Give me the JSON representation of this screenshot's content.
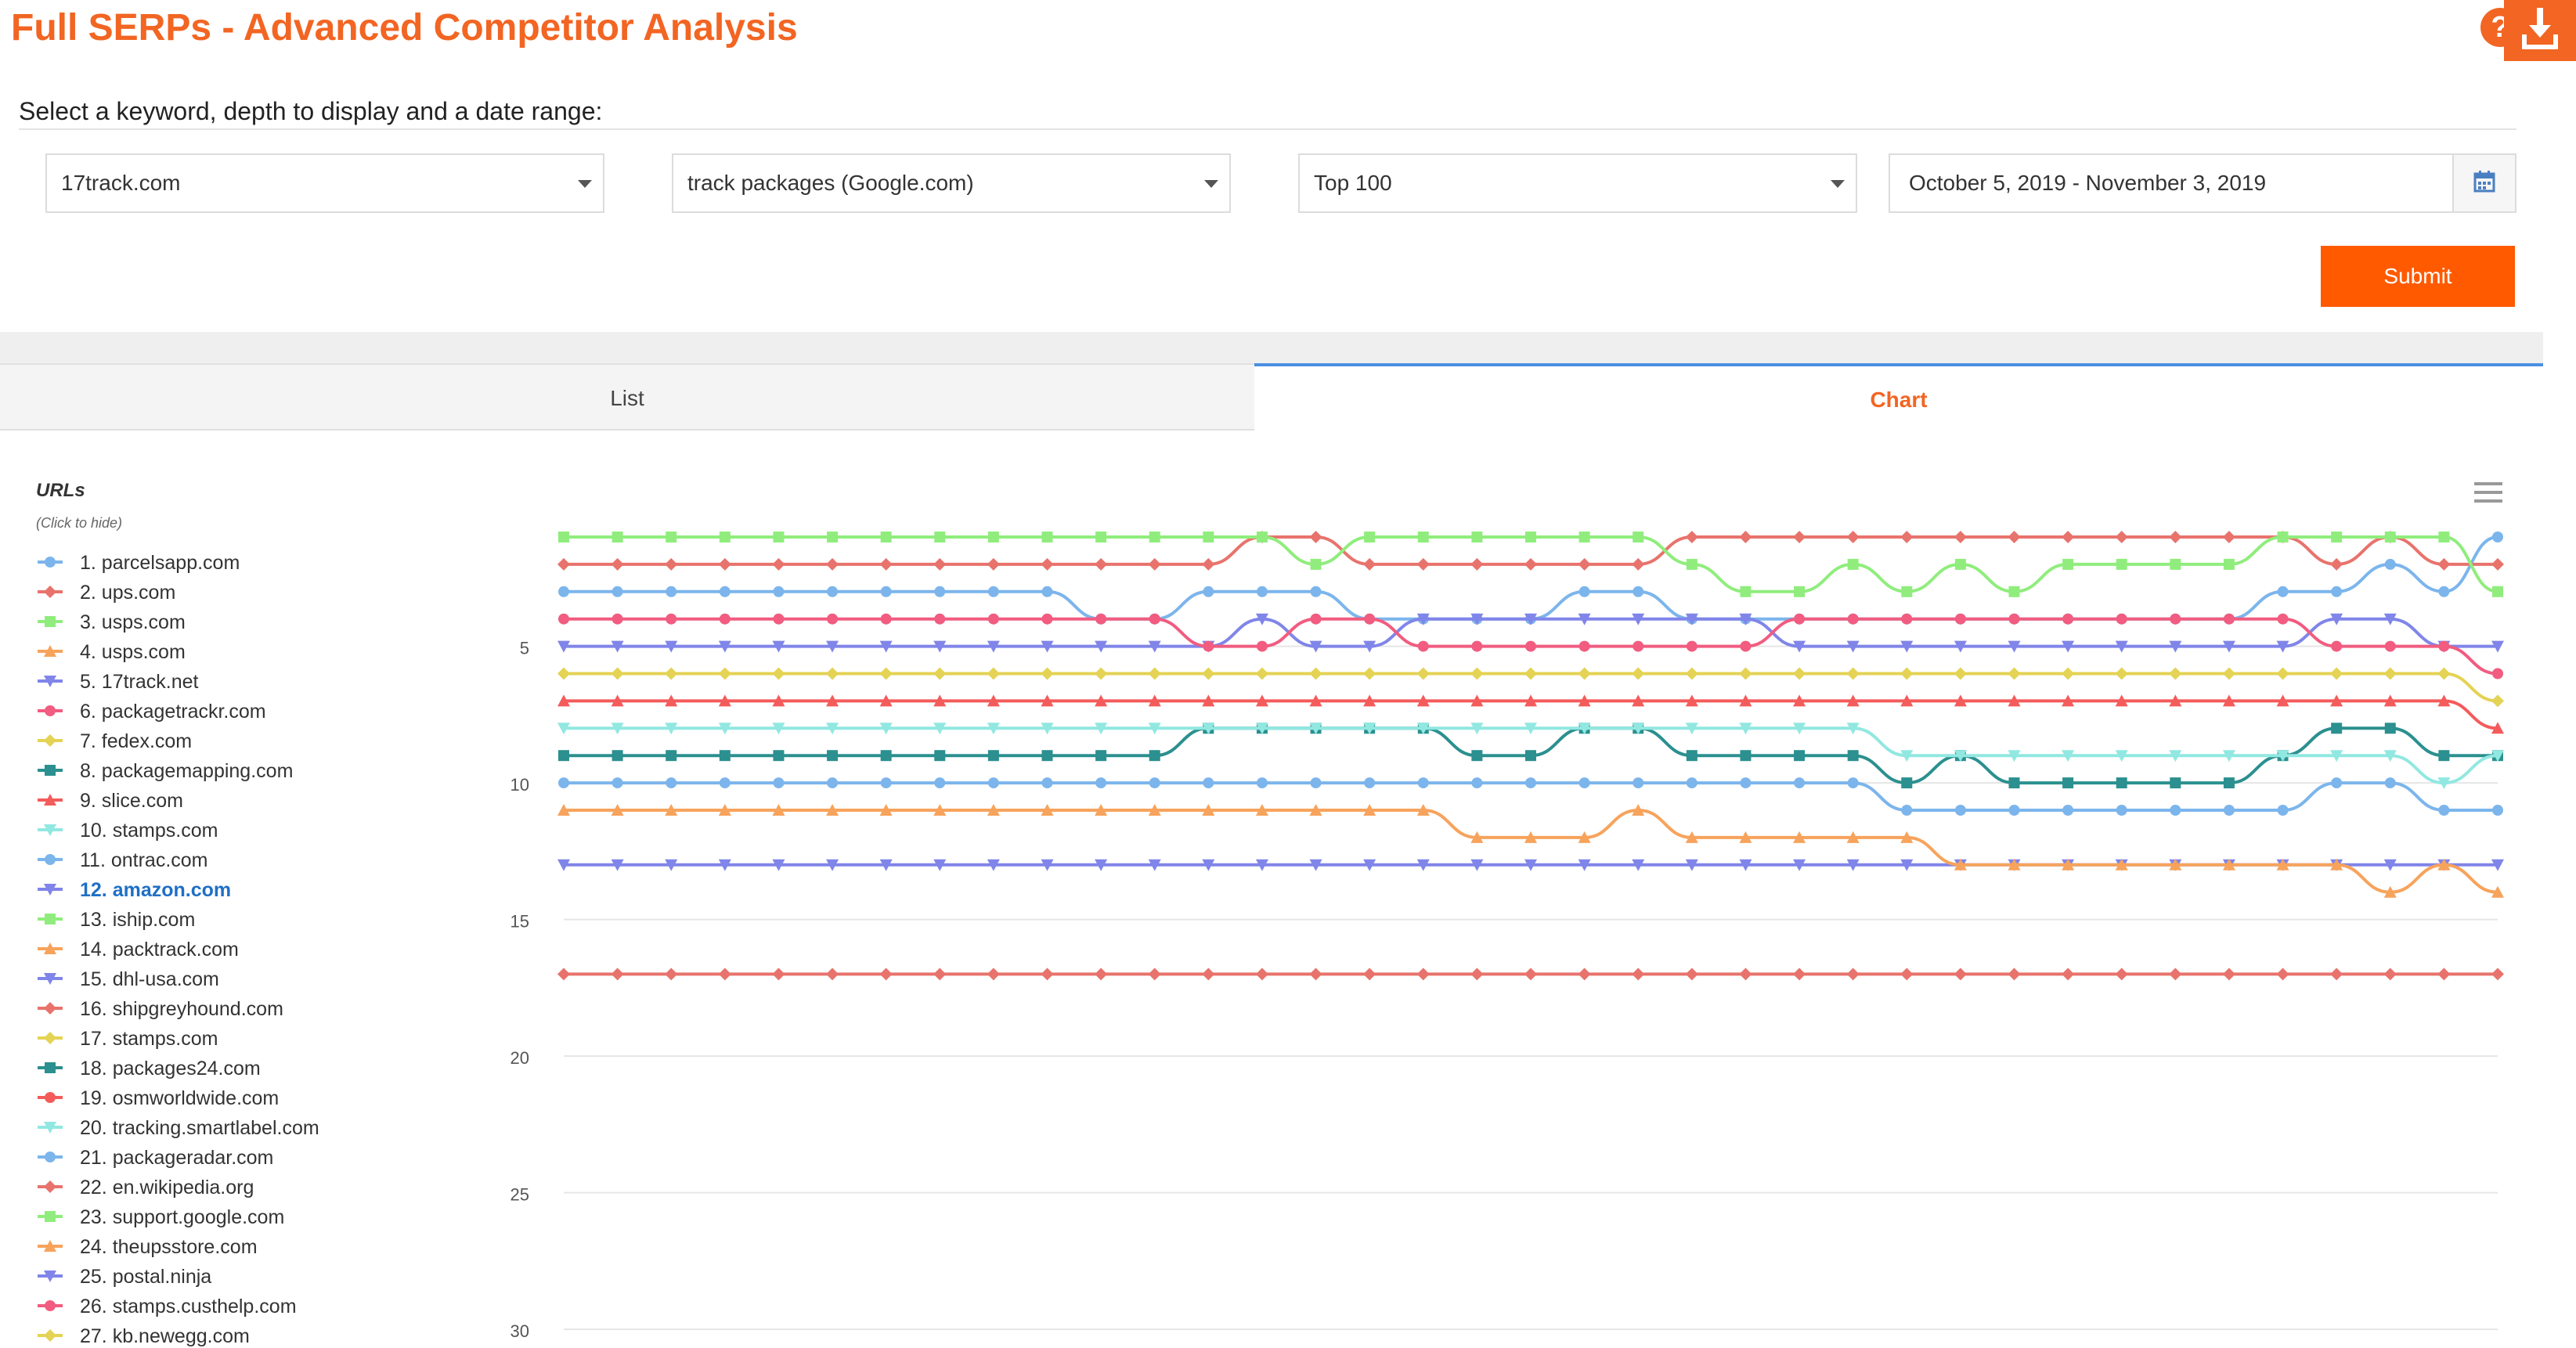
{
  "header": {
    "title": "Full SERPs - Advanced Competitor Analysis",
    "help_label": "?"
  },
  "form": {
    "heading": "Select a keyword, depth to display and a date range:",
    "domain": "17track.com",
    "keyword": "track packages (Google.com)",
    "depth": "Top 100",
    "date_range": "October 5, 2019 - November 3, 2019",
    "submit_label": "Submit"
  },
  "tabs": {
    "list_label": "List",
    "chart_label": "Chart",
    "active": "Chart"
  },
  "colors": {
    "accent": "#f26522",
    "submit": "#ff5a00",
    "tab_active_border": "#4a90e2",
    "highlight": "#1f6fc5"
  },
  "icons": {
    "help": "help-icon",
    "download": "download-icon",
    "calendar": "calendar-icon",
    "menu": "hamburger-menu-icon"
  },
  "chart_data": {
    "type": "line",
    "legend_title": "URLs",
    "legend_hint": "(Click to hide)",
    "legend_placement": "left",
    "highlighted": "12. amazon.com",
    "y_ticks": [
      5,
      10,
      15,
      20,
      25,
      30
    ],
    "ylim": [
      1,
      30
    ],
    "y_reversed": true,
    "grid": true,
    "series": [
      {
        "name": "1. parcelsapp.com",
        "color": "#7cb5ec",
        "marker": "circle",
        "values": [
          3,
          3,
          3,
          3,
          3,
          3,
          3,
          3,
          3,
          3,
          4,
          4,
          3,
          3,
          3,
          4,
          4,
          4,
          4,
          3,
          3,
          4,
          4,
          4,
          4,
          4,
          4,
          4,
          4,
          4,
          4,
          4,
          3,
          3,
          2,
          3,
          1
        ]
      },
      {
        "name": "2. ups.com",
        "color": "#e8736c",
        "marker": "diamond",
        "values": [
          2,
          2,
          2,
          2,
          2,
          2,
          2,
          2,
          2,
          2,
          2,
          2,
          2,
          1,
          1,
          2,
          2,
          2,
          2,
          2,
          2,
          1,
          1,
          1,
          1,
          1,
          1,
          1,
          1,
          1,
          1,
          1,
          1,
          2,
          1,
          2,
          2
        ]
      },
      {
        "name": "3. usps.com",
        "color": "#90ed7d",
        "marker": "square",
        "values": [
          1,
          1,
          1,
          1,
          1,
          1,
          1,
          1,
          1,
          1,
          1,
          1,
          1,
          1,
          2,
          1,
          1,
          1,
          1,
          1,
          1,
          2,
          3,
          3,
          2,
          3,
          2,
          3,
          2,
          2,
          2,
          2,
          1,
          1,
          1,
          1,
          3
        ]
      },
      {
        "name": "4. usps.com",
        "color": "#f7a35c",
        "marker": "triangle",
        "values": [
          null,
          null,
          null,
          null,
          null,
          null,
          null,
          null,
          null,
          null,
          null,
          null,
          null,
          null,
          null,
          null,
          null,
          null,
          null,
          null,
          null,
          null,
          null,
          null,
          null,
          null,
          null,
          null,
          null,
          null,
          null,
          null,
          null,
          null,
          null,
          null,
          null
        ]
      },
      {
        "name": "5. 17track.net",
        "color": "#8085e9",
        "marker": "triangle-down",
        "values": [
          5,
          5,
          5,
          5,
          5,
          5,
          5,
          5,
          5,
          5,
          5,
          5,
          5,
          4,
          5,
          5,
          4,
          4,
          4,
          4,
          4,
          4,
          4,
          5,
          5,
          5,
          5,
          5,
          5,
          5,
          5,
          5,
          5,
          4,
          4,
          5,
          5
        ]
      },
      {
        "name": "6. packagetrackr.com",
        "color": "#f15c80",
        "marker": "circle",
        "values": [
          4,
          4,
          4,
          4,
          4,
          4,
          4,
          4,
          4,
          4,
          4,
          4,
          5,
          5,
          4,
          4,
          5,
          5,
          5,
          5,
          5,
          5,
          5,
          4,
          4,
          4,
          4,
          4,
          4,
          4,
          4,
          4,
          4,
          5,
          5,
          5,
          6
        ]
      },
      {
        "name": "7. fedex.com",
        "color": "#e4d354",
        "marker": "diamond",
        "values": [
          6,
          6,
          6,
          6,
          6,
          6,
          6,
          6,
          6,
          6,
          6,
          6,
          6,
          6,
          6,
          6,
          6,
          6,
          6,
          6,
          6,
          6,
          6,
          6,
          6,
          6,
          6,
          6,
          6,
          6,
          6,
          6,
          6,
          6,
          6,
          6,
          7
        ]
      },
      {
        "name": "8. packagemapping.com",
        "color": "#2b908f",
        "marker": "square",
        "values": [
          9,
          9,
          9,
          9,
          9,
          9,
          9,
          9,
          9,
          9,
          9,
          9,
          8,
          8,
          8,
          8,
          8,
          9,
          9,
          8,
          8,
          9,
          9,
          9,
          9,
          10,
          9,
          10,
          10,
          10,
          10,
          10,
          9,
          8,
          8,
          9,
          9
        ]
      },
      {
        "name": "9. slice.com",
        "color": "#f45b5b",
        "marker": "triangle",
        "values": [
          7,
          7,
          7,
          7,
          7,
          7,
          7,
          7,
          7,
          7,
          7,
          7,
          7,
          7,
          7,
          7,
          7,
          7,
          7,
          7,
          7,
          7,
          7,
          7,
          7,
          7,
          7,
          7,
          7,
          7,
          7,
          7,
          7,
          7,
          7,
          7,
          8
        ]
      },
      {
        "name": "10. stamps.com",
        "color": "#91e8e1",
        "marker": "triangle-down",
        "values": [
          8,
          8,
          8,
          8,
          8,
          8,
          8,
          8,
          8,
          8,
          8,
          8,
          8,
          8,
          8,
          8,
          8,
          8,
          8,
          8,
          8,
          8,
          8,
          8,
          8,
          9,
          9,
          9,
          9,
          9,
          9,
          9,
          9,
          9,
          9,
          10,
          9
        ]
      },
      {
        "name": "11. ontrac.com",
        "color": "#7cb5ec",
        "marker": "circle",
        "values": [
          10,
          10,
          10,
          10,
          10,
          10,
          10,
          10,
          10,
          10,
          10,
          10,
          10,
          10,
          10,
          10,
          10,
          10,
          10,
          10,
          10,
          10,
          10,
          10,
          10,
          11,
          11,
          11,
          11,
          11,
          11,
          11,
          11,
          10,
          10,
          11,
          11
        ]
      },
      {
        "name": "12. amazon.com",
        "color": "#8085e9",
        "marker": "triangle-down",
        "values": [
          13,
          13,
          13,
          13,
          13,
          13,
          13,
          13,
          13,
          13,
          13,
          13,
          13,
          13,
          13,
          13,
          13,
          13,
          13,
          13,
          13,
          13,
          13,
          13,
          13,
          13,
          13,
          13,
          13,
          13,
          13,
          13,
          13,
          13,
          13,
          13,
          13
        ]
      },
      {
        "name": "13. iship.com",
        "color": "#90ed7d",
        "marker": "square",
        "values": [
          null,
          null,
          null,
          null,
          null,
          null,
          null,
          null,
          null,
          null,
          null,
          null,
          null,
          null,
          null,
          null,
          null,
          null,
          null,
          null,
          null,
          null,
          null,
          null,
          null,
          null,
          null,
          null,
          null,
          null,
          null,
          null,
          null,
          null,
          null,
          null,
          null
        ]
      },
      {
        "name": "14. packtrack.com",
        "color": "#f7a35c",
        "marker": "triangle",
        "values": [
          11,
          11,
          11,
          11,
          11,
          11,
          11,
          11,
          11,
          11,
          11,
          11,
          11,
          11,
          11,
          11,
          11,
          12,
          12,
          12,
          11,
          12,
          12,
          12,
          12,
          12,
          13,
          13,
          13,
          13,
          13,
          13,
          13,
          13,
          14,
          13,
          14
        ]
      },
      {
        "name": "15. dhl-usa.com",
        "color": "#8085e9",
        "marker": "triangle-down",
        "values": [
          null,
          null,
          null,
          null,
          null,
          null,
          null,
          null,
          null,
          null,
          null,
          null,
          null,
          null,
          null,
          null,
          null,
          null,
          null,
          null,
          null,
          null,
          null,
          null,
          null,
          null,
          null,
          null,
          null,
          null,
          null,
          null,
          null,
          null,
          null,
          null,
          null
        ]
      },
      {
        "name": "16. shipgreyhound.com",
        "color": "#e8736c",
        "marker": "diamond",
        "values": [
          17,
          17,
          17,
          17,
          17,
          17,
          17,
          17,
          17,
          17,
          17,
          17,
          17,
          17,
          17,
          17,
          17,
          17,
          17,
          17,
          17,
          17,
          17,
          17,
          17,
          17,
          17,
          17,
          17,
          17,
          17,
          17,
          17,
          17,
          17,
          17,
          17
        ]
      },
      {
        "name": "17. stamps.com",
        "color": "#e4d354",
        "marker": "diamond",
        "values": [
          null,
          null,
          null,
          null,
          null,
          null,
          null,
          null,
          null,
          null,
          null,
          null,
          null,
          null,
          null,
          null,
          null,
          null,
          null,
          null,
          null,
          null,
          null,
          null,
          null,
          null,
          null,
          null,
          null,
          null,
          null,
          null,
          null,
          null,
          null,
          null,
          null
        ]
      },
      {
        "name": "18. packages24.com",
        "color": "#2b908f",
        "marker": "square",
        "values": [
          null,
          null,
          null,
          null,
          null,
          null,
          null,
          null,
          null,
          null,
          null,
          null,
          null,
          null,
          null,
          null,
          null,
          null,
          null,
          null,
          null,
          null,
          null,
          null,
          null,
          null,
          null,
          null,
          null,
          null,
          null,
          null,
          null,
          null,
          null,
          null,
          null
        ]
      },
      {
        "name": "19. osmworldwide.com",
        "color": "#f45b5b",
        "marker": "circle",
        "values": [
          null,
          null,
          null,
          null,
          null,
          null,
          null,
          null,
          null,
          null,
          null,
          null,
          null,
          null,
          null,
          null,
          null,
          null,
          null,
          null,
          null,
          null,
          null,
          null,
          null,
          null,
          null,
          null,
          null,
          null,
          null,
          null,
          null,
          null,
          null,
          null,
          null
        ]
      },
      {
        "name": "20. tracking.smartlabel.com",
        "color": "#91e8e1",
        "marker": "triangle-down",
        "values": [
          null,
          null,
          null,
          null,
          null,
          null,
          null,
          null,
          null,
          null,
          null,
          null,
          null,
          null,
          null,
          null,
          null,
          null,
          null,
          null,
          null,
          null,
          null,
          null,
          null,
          null,
          null,
          null,
          null,
          null,
          null,
          null,
          null,
          null,
          null,
          null,
          null
        ]
      },
      {
        "name": "21. packageradar.com",
        "color": "#7cb5ec",
        "marker": "circle",
        "values": [
          null,
          null,
          null,
          null,
          null,
          null,
          null,
          null,
          null,
          null,
          null,
          null,
          null,
          null,
          null,
          null,
          null,
          null,
          null,
          null,
          null,
          null,
          null,
          null,
          null,
          null,
          null,
          null,
          null,
          null,
          null,
          null,
          null,
          null,
          null,
          null,
          null
        ]
      },
      {
        "name": "22. en.wikipedia.org",
        "color": "#e8736c",
        "marker": "diamond",
        "values": [
          null,
          null,
          null,
          null,
          null,
          null,
          null,
          null,
          null,
          null,
          null,
          null,
          null,
          null,
          null,
          null,
          null,
          null,
          null,
          null,
          null,
          null,
          null,
          null,
          null,
          null,
          null,
          null,
          null,
          null,
          null,
          null,
          null,
          null,
          null,
          null,
          null
        ]
      },
      {
        "name": "23. support.google.com",
        "color": "#90ed7d",
        "marker": "square",
        "values": [
          null,
          null,
          null,
          null,
          null,
          null,
          null,
          null,
          null,
          null,
          null,
          null,
          null,
          null,
          null,
          null,
          null,
          null,
          null,
          null,
          null,
          null,
          null,
          null,
          null,
          null,
          null,
          null,
          null,
          null,
          null,
          null,
          null,
          null,
          null,
          null,
          null
        ]
      },
      {
        "name": "24. theupsstore.com",
        "color": "#f7a35c",
        "marker": "triangle",
        "values": [
          null,
          null,
          null,
          null,
          null,
          null,
          null,
          null,
          null,
          null,
          null,
          null,
          null,
          null,
          null,
          null,
          null,
          null,
          null,
          null,
          null,
          null,
          null,
          null,
          null,
          null,
          null,
          null,
          null,
          null,
          null,
          null,
          null,
          null,
          null,
          null,
          null
        ]
      },
      {
        "name": "25. postal.ninja",
        "color": "#8085e9",
        "marker": "triangle-down",
        "values": [
          null,
          null,
          null,
          null,
          null,
          null,
          null,
          null,
          null,
          null,
          null,
          null,
          null,
          null,
          null,
          null,
          null,
          null,
          null,
          null,
          null,
          null,
          null,
          null,
          null,
          null,
          null,
          null,
          null,
          null,
          null,
          null,
          null,
          null,
          null,
          null,
          null
        ]
      },
      {
        "name": "26. stamps.custhelp.com",
        "color": "#f15c80",
        "marker": "circle",
        "values": [
          null,
          null,
          null,
          null,
          null,
          null,
          null,
          null,
          null,
          null,
          null,
          null,
          null,
          null,
          null,
          null,
          null,
          null,
          null,
          null,
          null,
          null,
          null,
          null,
          null,
          null,
          null,
          null,
          null,
          null,
          null,
          null,
          null,
          null,
          null,
          null,
          null
        ]
      },
      {
        "name": "27. kb.newegg.com",
        "color": "#e4d354",
        "marker": "diamond",
        "values": [
          null,
          null,
          null,
          null,
          null,
          null,
          null,
          null,
          null,
          null,
          null,
          null,
          null,
          null,
          null,
          null,
          null,
          null,
          null,
          null,
          null,
          null,
          null,
          null,
          null,
          null,
          null,
          null,
          null,
          null,
          null,
          null,
          null,
          null,
          null,
          null,
          null
        ]
      }
    ]
  }
}
